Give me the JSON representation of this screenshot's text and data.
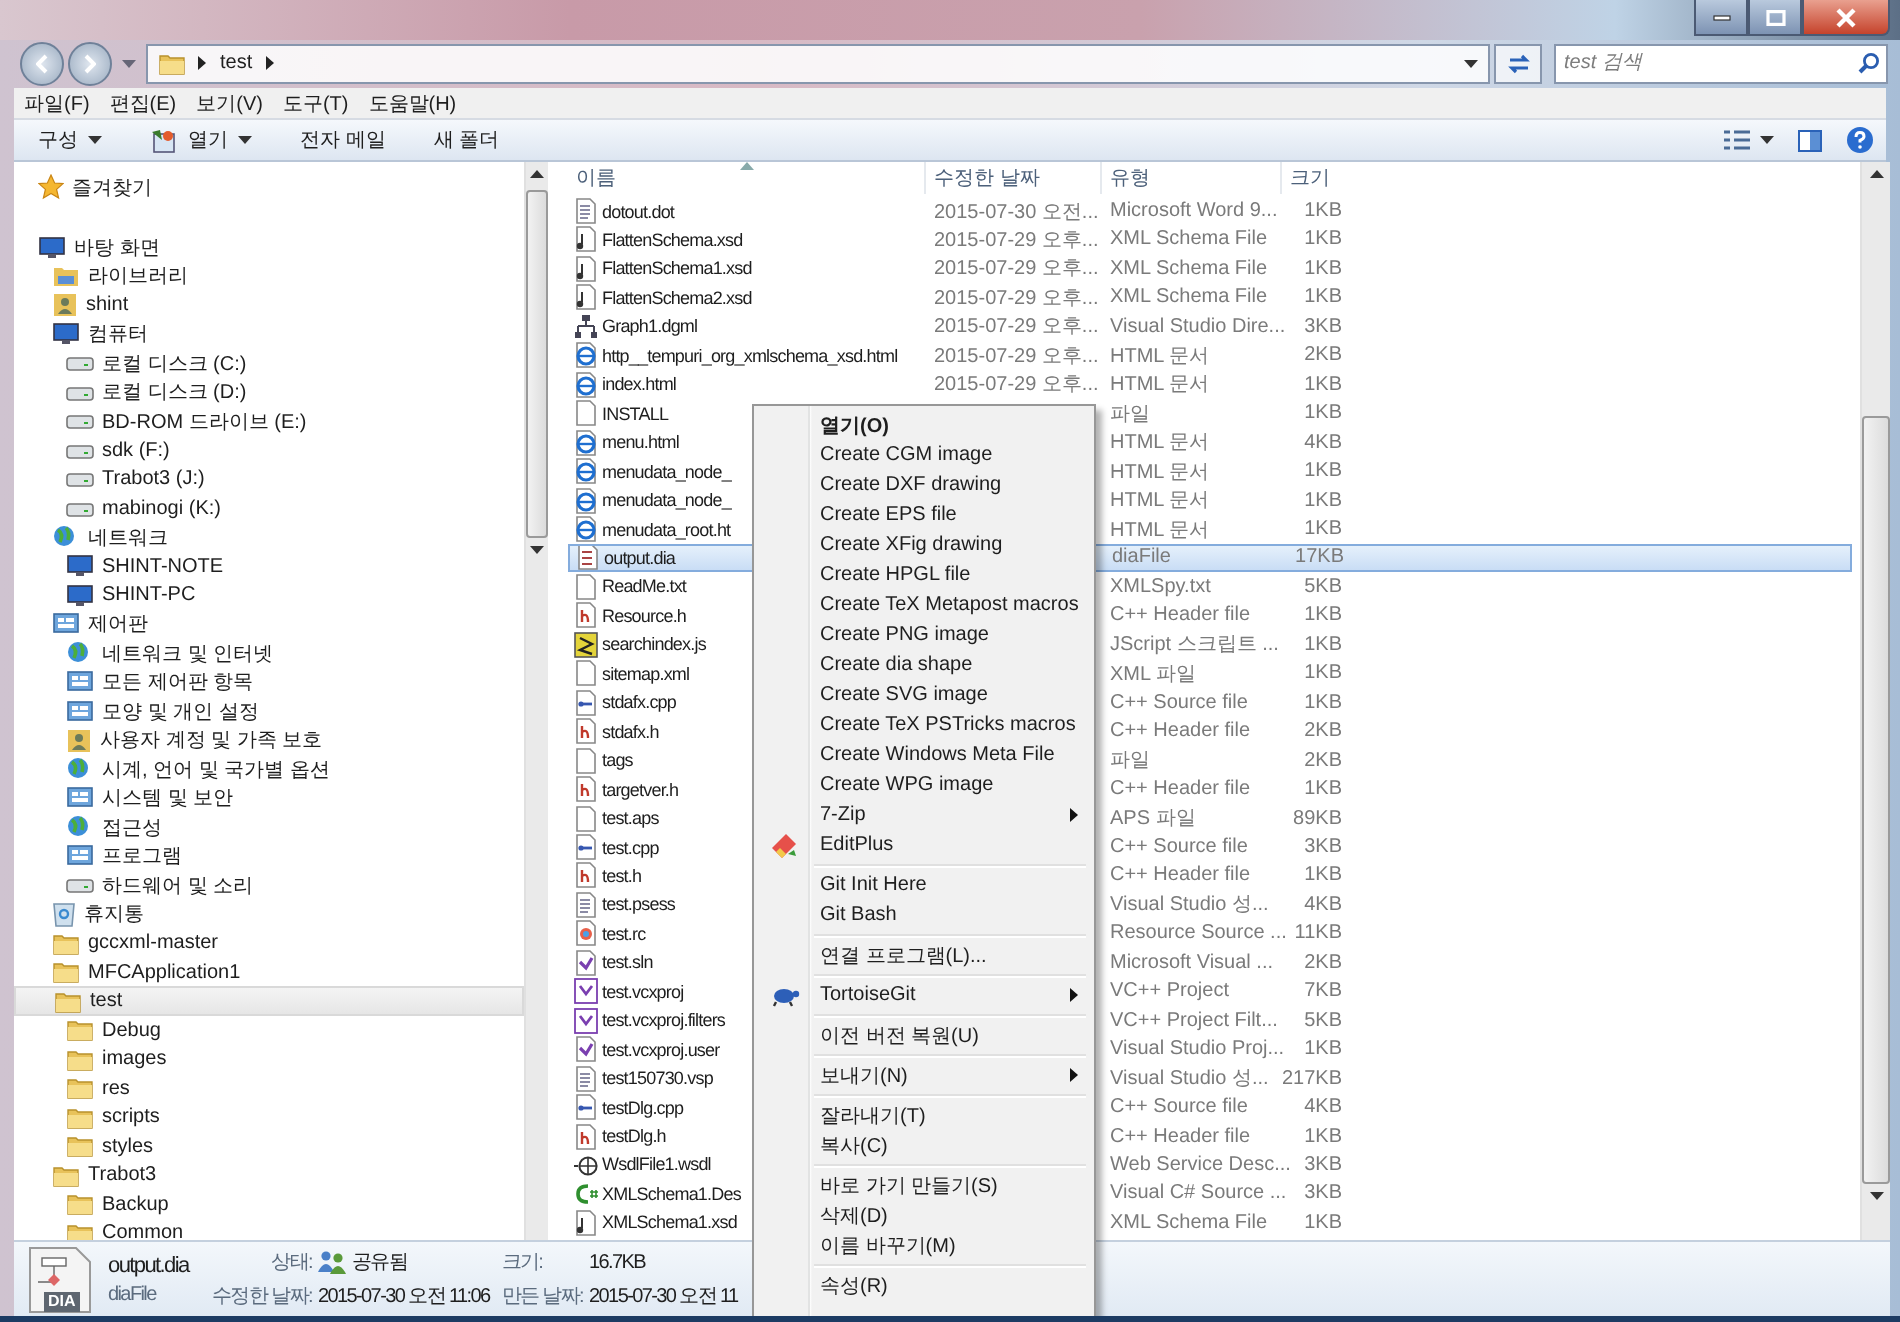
{
  "address_bar": {
    "path": [
      {
        "label": "test"
      }
    ],
    "search_placeholder": "test 검색"
  },
  "menu_bar": [
    "파일(F)",
    "편집(E)",
    "보기(V)",
    "도구(T)",
    "도움말(H)"
  ],
  "toolbar": [
    {
      "label": "구성",
      "kind": "dropdown"
    },
    {
      "label": "열기",
      "kind": "icon-dropdown"
    },
    {
      "label": "전자 메일",
      "kind": "plain"
    },
    {
      "label": "새 폴더",
      "kind": "plain"
    }
  ],
  "nav_pane": {
    "items": [
      {
        "label": "즐겨찾기",
        "kind": "star",
        "selected": false
      },
      {
        "label": "바탕 화면",
        "kind": "monitor",
        "selected": false,
        "children": [
          {
            "label": "라이브러리",
            "kind": "library",
            "selected": false
          },
          {
            "label": "shint",
            "kind": "user",
            "selected": false
          },
          {
            "label": "컴퓨터",
            "kind": "monitor",
            "selected": false,
            "children": [
              {
                "label": "로컬 디스크 (C:)",
                "kind": "drive",
                "selected": false
              },
              {
                "label": "로컬 디스크 (D:)",
                "kind": "drive",
                "selected": false
              },
              {
                "label": "BD-ROM 드라이브 (E:)",
                "kind": "drive",
                "selected": false
              },
              {
                "label": "sdk (F:)",
                "kind": "drive",
                "selected": false
              },
              {
                "label": "Trabot3 (J:)",
                "kind": "drive",
                "selected": false
              },
              {
                "label": "mabinogi (K:)",
                "kind": "drive",
                "selected": false
              }
            ]
          },
          {
            "label": "네트워크",
            "kind": "network",
            "selected": false,
            "children": [
              {
                "label": "SHINT-NOTE",
                "kind": "monitor",
                "selected": false
              },
              {
                "label": "SHINT-PC",
                "kind": "monitor",
                "selected": false
              }
            ]
          },
          {
            "label": "제어판",
            "kind": "control",
            "selected": false,
            "children": [
              {
                "label": "네트워크 및 인터넷",
                "kind": "network",
                "selected": false
              },
              {
                "label": "모든 제어판 항목",
                "kind": "control",
                "selected": false
              },
              {
                "label": "모양 및 개인 설정",
                "kind": "control",
                "selected": false
              },
              {
                "label": "사용자 계정 및 가족 보호",
                "kind": "user",
                "selected": false
              },
              {
                "label": "시계, 언어 및 국가별 옵션",
                "kind": "network",
                "selected": false
              },
              {
                "label": "시스템 및 보안",
                "kind": "control",
                "selected": false
              },
              {
                "label": "접근성",
                "kind": "network",
                "selected": false
              },
              {
                "label": "프로그램",
                "kind": "control",
                "selected": false
              },
              {
                "label": "하드웨어 및 소리",
                "kind": "drive",
                "selected": false
              }
            ]
          },
          {
            "label": "휴지통",
            "kind": "recycle",
            "selected": false
          },
          {
            "label": "gccxml-master",
            "kind": "folder",
            "selected": false
          },
          {
            "label": "MFCApplication1",
            "kind": "folder",
            "selected": false
          },
          {
            "label": "test",
            "kind": "folder",
            "selected": true,
            "children": [
              {
                "label": "Debug",
                "kind": "folder",
                "selected": false
              },
              {
                "label": "images",
                "kind": "folder",
                "selected": false
              },
              {
                "label": "res",
                "kind": "folder",
                "selected": false
              },
              {
                "label": "scripts",
                "kind": "folder",
                "selected": false
              },
              {
                "label": "styles",
                "kind": "folder",
                "selected": false
              }
            ]
          },
          {
            "label": "Trabot3",
            "kind": "folder",
            "selected": false,
            "children": [
              {
                "label": "Backup",
                "kind": "folder",
                "selected": false
              },
              {
                "label": "Common",
                "kind": "folder",
                "selected": false
              }
            ]
          }
        ]
      }
    ]
  },
  "file_list": {
    "columns": [
      "이름",
      "수정한 날짜",
      "유형",
      "크기"
    ],
    "rows": [
      {
        "name": "dotout.dot",
        "kind": "document",
        "date": "2015-07-30 오전...",
        "type": "Microsoft Word 9...",
        "size": "1KB",
        "selected": false
      },
      {
        "name": "FlattenSchema.xsd",
        "kind": "schema",
        "date": "2015-07-29 오후...",
        "type": "XML Schema File",
        "size": "1KB",
        "selected": false
      },
      {
        "name": "FlattenSchema1.xsd",
        "kind": "schema",
        "date": "2015-07-29 오후...",
        "type": "XML Schema File",
        "size": "1KB",
        "selected": false
      },
      {
        "name": "FlattenSchema2.xsd",
        "kind": "schema",
        "date": "2015-07-29 오후...",
        "type": "XML Schema File",
        "size": "1KB",
        "selected": false
      },
      {
        "name": "Graph1.dgml",
        "kind": "graph",
        "date": "2015-07-29 오후...",
        "type": "Visual Studio Dire...",
        "size": "3KB",
        "selected": false
      },
      {
        "name": "http__tempuri_org_xmlschema_xsd.html",
        "kind": "web",
        "date": "2015-07-29 오후...",
        "type": "HTML 문서",
        "size": "2KB",
        "selected": false
      },
      {
        "name": "index.html",
        "kind": "web",
        "date": "2015-07-29 오후...",
        "type": "HTML 문서",
        "size": "1KB",
        "selected": false
      },
      {
        "name": "INSTALL",
        "kind": "blank",
        "type": "파일",
        "size": "1KB",
        "selected": false
      },
      {
        "name": "menu.html",
        "kind": "web",
        "type": "HTML 문서",
        "size": "4KB",
        "selected": false
      },
      {
        "name": "menudata_node_",
        "kind": "web",
        "type": "HTML 문서",
        "size": "1KB",
        "selected": false
      },
      {
        "name": "menudata_node_",
        "kind": "web",
        "type": "HTML 문서",
        "size": "1KB",
        "selected": false
      },
      {
        "name": "menudata_root.ht",
        "kind": "web",
        "type": "HTML 문서",
        "size": "1KB",
        "selected": false
      },
      {
        "name": "output.dia",
        "kind": "diagram",
        "type": "diaFile",
        "size": "17KB",
        "selected": true
      },
      {
        "name": "ReadMe.txt",
        "kind": "blank",
        "type": "XMLSpy.txt",
        "size": "5KB",
        "selected": false
      },
      {
        "name": "Resource.h",
        "kind": "header",
        "type": "C++ Header file",
        "size": "1KB",
        "selected": false
      },
      {
        "name": "searchindex.js",
        "kind": "script",
        "type": "JScript 스크립트 ...",
        "size": "1KB",
        "selected": false
      },
      {
        "name": "sitemap.xml",
        "kind": "blank",
        "type": "XML 파일",
        "size": "1KB",
        "selected": false
      },
      {
        "name": "stdafx.cpp",
        "kind": "source",
        "type": "C++ Source file",
        "size": "1KB",
        "selected": false
      },
      {
        "name": "stdafx.h",
        "kind": "header",
        "type": "C++ Header file",
        "size": "2KB",
        "selected": false
      },
      {
        "name": "tags",
        "kind": "blank",
        "type": "파일",
        "size": "2KB",
        "selected": false
      },
      {
        "name": "targetver.h",
        "kind": "header",
        "type": "C++ Header file",
        "size": "1KB",
        "selected": false
      },
      {
        "name": "test.aps",
        "kind": "blank",
        "type": "APS 파일",
        "size": "89KB",
        "selected": false
      },
      {
        "name": "test.cpp",
        "kind": "source",
        "type": "C++ Source file",
        "size": "3KB",
        "selected": false
      },
      {
        "name": "test.h",
        "kind": "header",
        "type": "C++ Header file",
        "size": "1KB",
        "selected": false
      },
      {
        "name": "test.psess",
        "kind": "document",
        "type": "Visual Studio 성...",
        "size": "4KB",
        "selected": false
      },
      {
        "name": "test.rc",
        "kind": "resource",
        "type": "Resource Source ...",
        "size": "11KB",
        "selected": false
      },
      {
        "name": "test.sln",
        "kind": "solution",
        "type": "Microsoft Visual ...",
        "size": "2KB",
        "selected": false
      },
      {
        "name": "test.vcxproj",
        "kind": "project",
        "type": "VC++ Project",
        "size": "7KB",
        "selected": false
      },
      {
        "name": "test.vcxproj.filters",
        "kind": "project",
        "type": "VC++ Project Filt...",
        "size": "5KB",
        "selected": false
      },
      {
        "name": "test.vcxproj.user",
        "kind": "solution",
        "type": "Visual Studio Proj...",
        "size": "1KB",
        "selected": false
      },
      {
        "name": "test150730.vsp",
        "kind": "document",
        "type": "Visual Studio 성...",
        "size": "217KB",
        "selected": false
      },
      {
        "name": "testDlg.cpp",
        "kind": "source",
        "type": "C++ Source file",
        "size": "4KB",
        "selected": false
      },
      {
        "name": "testDlg.h",
        "kind": "header",
        "type": "C++ Header file",
        "size": "1KB",
        "selected": false
      },
      {
        "name": "WsdlFile1.wsdl",
        "kind": "service",
        "type": "Web Service Desc...",
        "size": "3KB",
        "selected": false
      },
      {
        "name": "XMLSchema1.Des",
        "kind": "csharp",
        "type": "Visual C# Source ...",
        "size": "3KB",
        "selected": false
      },
      {
        "name": "XMLSchema1.xsd",
        "kind": "schema",
        "type": "XML Schema File",
        "size": "1KB",
        "selected": false
      }
    ]
  },
  "context_menu": {
    "groups": [
      [
        {
          "label": "열기(O)",
          "kind": "default"
        },
        {
          "label": "Create CGM image",
          "kind": "command"
        },
        {
          "label": "Create DXF drawing",
          "kind": "command"
        },
        {
          "label": "Create EPS file",
          "kind": "command"
        },
        {
          "label": "Create XFig drawing",
          "kind": "command"
        },
        {
          "label": "Create HPGL file",
          "kind": "command"
        },
        {
          "label": "Create TeX Metapost macros",
          "kind": "command"
        },
        {
          "label": "Create PNG image",
          "kind": "command"
        },
        {
          "label": "Create dia shape",
          "kind": "command"
        },
        {
          "label": "Create SVG image",
          "kind": "command"
        },
        {
          "label": "Create TeX PSTricks macros",
          "kind": "command"
        },
        {
          "label": "Create Windows Meta File",
          "kind": "command"
        },
        {
          "label": "Create WPG image",
          "kind": "command"
        },
        {
          "label": "7-Zip",
          "kind": "submenu"
        },
        {
          "label": "EditPlus",
          "kind": "app-command"
        }
      ],
      [
        {
          "label": "Git Init Here",
          "kind": "command"
        },
        {
          "label": "Git Bash",
          "kind": "command"
        }
      ],
      [
        {
          "label": "연결 프로그램(L)...",
          "kind": "command"
        }
      ],
      [
        {
          "label": "TortoiseGit",
          "kind": "app-submenu"
        }
      ],
      [
        {
          "label": "이전 버전 복원(U)",
          "kind": "command"
        }
      ],
      [
        {
          "label": "보내기(N)",
          "kind": "submenu"
        }
      ],
      [
        {
          "label": "잘라내기(T)",
          "kind": "command"
        },
        {
          "label": "복사(C)",
          "kind": "command"
        }
      ],
      [
        {
          "label": "바로 가기 만들기(S)",
          "kind": "command"
        },
        {
          "label": "삭제(D)",
          "kind": "command"
        },
        {
          "label": "이름 바꾸기(M)",
          "kind": "command"
        }
      ],
      [
        {
          "label": "속성(R)",
          "kind": "command"
        }
      ]
    ]
  },
  "details_pane": {
    "icon_label": "DIA",
    "name": "output.dia",
    "type": "diaFile",
    "fields": [
      {
        "label": "상태:",
        "value": "공유됨",
        "kind": "shared"
      },
      {
        "label": "크기:",
        "value": "16.7KB",
        "kind": "plain"
      },
      {
        "label": "수정한 날짜:",
        "value": "2015-07-30 오전 11:06",
        "kind": "plain"
      },
      {
        "label": "만든 날짜:",
        "value": "2015-07-30 오전 11",
        "kind": "plain"
      }
    ]
  }
}
